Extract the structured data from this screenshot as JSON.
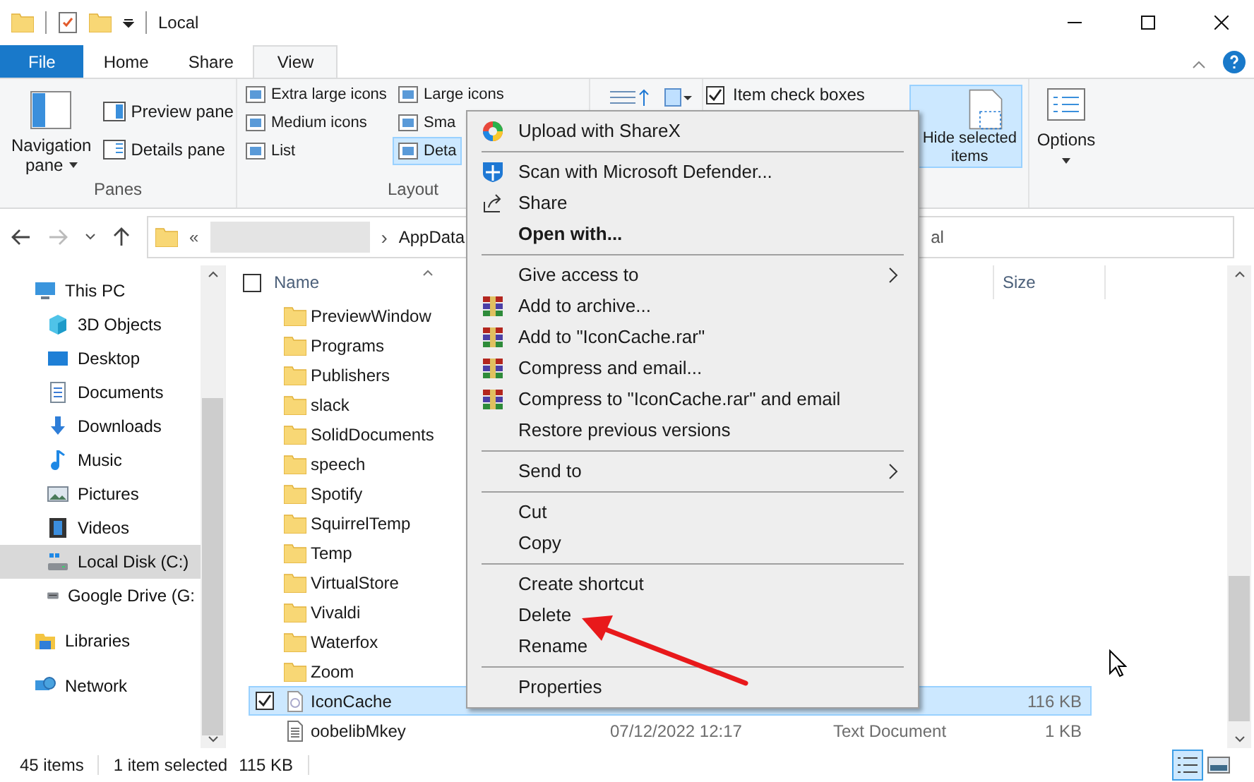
{
  "window": {
    "title": "Local"
  },
  "tabs": [
    {
      "label": "File",
      "kind": "file",
      "selected": false
    },
    {
      "label": "Home",
      "kind": "tab",
      "selected": false
    },
    {
      "label": "Share",
      "kind": "tab",
      "selected": false
    },
    {
      "label": "View",
      "kind": "tab",
      "selected": true
    }
  ],
  "ribbon": {
    "panes": {
      "navigation_pane": [
        "Navigation",
        "pane"
      ],
      "preview_pane": "Preview pane",
      "details_pane": "Details pane",
      "label": "Panes"
    },
    "layout": {
      "items": [
        {
          "label": "Extra large icons",
          "selected": false
        },
        {
          "label": "Large icons",
          "selected": false
        },
        {
          "label": "Medium icons",
          "selected": false
        },
        {
          "label": "Sma",
          "selected": false
        },
        {
          "label": "List",
          "selected": false
        },
        {
          "label": "Deta",
          "selected": true
        }
      ],
      "label": "Layout"
    },
    "item_check_boxes": {
      "label": "Item check boxes",
      "checked": true
    },
    "hide_selected": [
      "Hide selected",
      "items"
    ],
    "options": "Options"
  },
  "address": {
    "overflow": "«",
    "separator": "›",
    "crumb": "AppData",
    "tail": "al"
  },
  "nav": [
    {
      "label": "This PC",
      "kind": "pc",
      "selected": false,
      "children": [
        {
          "label": "3D Objects",
          "kind": "cube",
          "selected": false
        },
        {
          "label": "Desktop",
          "kind": "desktop",
          "selected": false
        },
        {
          "label": "Documents",
          "kind": "documents",
          "selected": false
        },
        {
          "label": "Downloads",
          "kind": "downloads",
          "selected": false
        },
        {
          "label": "Music",
          "kind": "music",
          "selected": false
        },
        {
          "label": "Pictures",
          "kind": "pictures",
          "selected": false
        },
        {
          "label": "Videos",
          "kind": "videos",
          "selected": false
        },
        {
          "label": "Local Disk (C:)",
          "kind": "disk",
          "selected": true
        },
        {
          "label": "Google Drive (G:",
          "kind": "drive",
          "selected": false
        }
      ]
    },
    {
      "label": "Libraries",
      "kind": "libraries",
      "selected": false
    },
    {
      "label": "Network",
      "kind": "network",
      "selected": false
    }
  ],
  "columns": {
    "name": "Name",
    "size": "Size",
    "select_all_checked": false
  },
  "files": [
    {
      "name": "PreviewWindow",
      "kind": "folder",
      "selected": false,
      "checked": false
    },
    {
      "name": "Programs",
      "kind": "folder",
      "selected": false,
      "checked": false
    },
    {
      "name": "Publishers",
      "kind": "folder",
      "selected": false,
      "checked": false
    },
    {
      "name": "slack",
      "kind": "folder",
      "selected": false,
      "checked": false
    },
    {
      "name": "SolidDocuments",
      "kind": "folder",
      "selected": false,
      "checked": false
    },
    {
      "name": "speech",
      "kind": "folder",
      "selected": false,
      "checked": false
    },
    {
      "name": "Spotify",
      "kind": "folder",
      "selected": false,
      "checked": false
    },
    {
      "name": "SquirrelTemp",
      "kind": "folder",
      "selected": false,
      "checked": false
    },
    {
      "name": "Temp",
      "kind": "folder",
      "selected": false,
      "checked": false
    },
    {
      "name": "VirtualStore",
      "kind": "folder",
      "selected": false,
      "checked": false
    },
    {
      "name": "Vivaldi",
      "kind": "folder",
      "selected": false,
      "checked": false
    },
    {
      "name": "Waterfox",
      "kind": "folder",
      "selected": false,
      "checked": false
    },
    {
      "name": "Zoom",
      "kind": "folder",
      "selected": false,
      "checked": false
    },
    {
      "name": "IconCache",
      "kind": "db",
      "selected": true,
      "checked": true,
      "size": "116 KB"
    },
    {
      "name": "oobelibMkey",
      "kind": "text",
      "selected": false,
      "checked": false,
      "date": "07/12/2022 12:17",
      "type": "Text Document",
      "size": "1 KB"
    }
  ],
  "status_bar": {
    "count": "45 items",
    "selection": "1 item selected",
    "selection_size": "115 KB",
    "views": [
      {
        "kind": "details",
        "selected": true
      },
      {
        "kind": "large",
        "selected": false
      }
    ]
  },
  "context_menu": [
    {
      "kind": "sharex",
      "label": "Upload with ShareX"
    },
    {
      "kind": "separator"
    },
    {
      "kind": "defender",
      "label": "Scan with Microsoft Defender..."
    },
    {
      "kind": "share",
      "label": "Share"
    },
    {
      "kind": "item",
      "label": "Open with...",
      "bold": true
    },
    {
      "kind": "separator"
    },
    {
      "kind": "item",
      "label": "Give access to",
      "submenu": true
    },
    {
      "kind": "archive",
      "label": "Add to archive..."
    },
    {
      "kind": "archive",
      "label": "Add to \"IconCache.rar\""
    },
    {
      "kind": "archive",
      "label": "Compress and email..."
    },
    {
      "kind": "archive",
      "label": "Compress to \"IconCache.rar\" and email"
    },
    {
      "kind": "item",
      "label": "Restore previous versions"
    },
    {
      "kind": "separator"
    },
    {
      "kind": "item",
      "label": "Send to",
      "submenu": true
    },
    {
      "kind": "separator"
    },
    {
      "kind": "item",
      "label": "Cut"
    },
    {
      "kind": "item",
      "label": "Copy"
    },
    {
      "kind": "separator"
    },
    {
      "kind": "item",
      "label": "Create shortcut"
    },
    {
      "kind": "item",
      "label": "Delete"
    },
    {
      "kind": "item",
      "label": "Rename"
    },
    {
      "kind": "separator"
    },
    {
      "kind": "item",
      "label": "Properties"
    }
  ]
}
